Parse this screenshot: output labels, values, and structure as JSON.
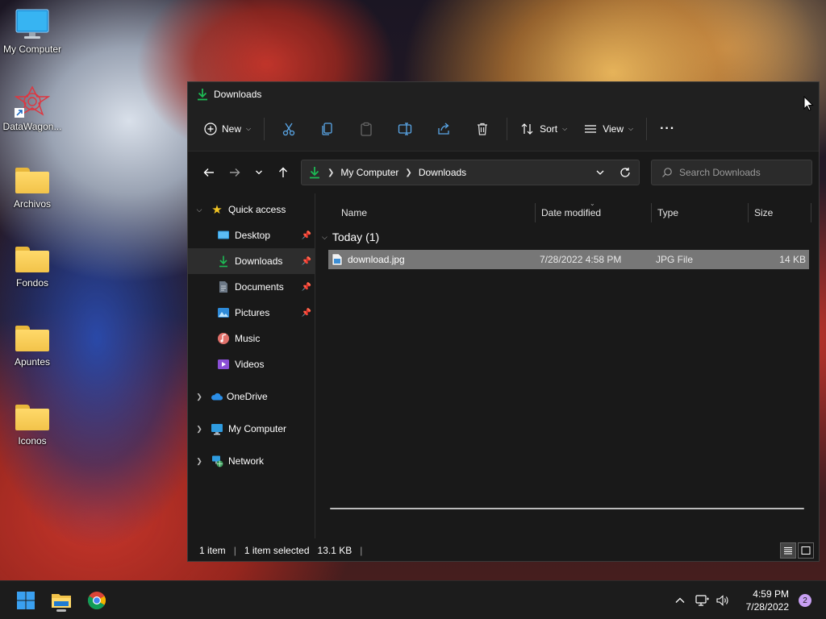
{
  "desktop": {
    "icons": [
      {
        "label": "My Computer",
        "icon": "monitor-icon"
      },
      {
        "label": "DataWagon...",
        "icon": "datawagon-shortcut-icon"
      },
      {
        "label": "Archivos",
        "icon": "folder-icon"
      },
      {
        "label": "Fondos",
        "icon": "folder-icon"
      },
      {
        "label": "Apuntes",
        "icon": "folder-icon"
      },
      {
        "label": "Iconos",
        "icon": "folder-icon"
      }
    ]
  },
  "window": {
    "title": "Downloads",
    "toolbar": {
      "new_label": "New",
      "sort_label": "Sort",
      "view_label": "View",
      "more_label": "···"
    },
    "address": {
      "crumbs": [
        "My Computer",
        "Downloads"
      ]
    },
    "search": {
      "placeholder": "Search Downloads"
    },
    "nav": {
      "quick_access": "Quick access",
      "items": [
        {
          "label": "Desktop",
          "pinned": true
        },
        {
          "label": "Downloads",
          "pinned": true,
          "selected": true
        },
        {
          "label": "Documents",
          "pinned": true
        },
        {
          "label": "Pictures",
          "pinned": true
        },
        {
          "label": "Music",
          "pinned": false
        },
        {
          "label": "Videos",
          "pinned": false
        }
      ],
      "roots": [
        {
          "label": "OneDrive"
        },
        {
          "label": "My Computer"
        },
        {
          "label": "Network"
        }
      ]
    },
    "columns": [
      "Name",
      "Date modified",
      "Type",
      "Size"
    ],
    "groups": [
      {
        "label": "Today (1)",
        "files": [
          {
            "name": "download.jpg",
            "date": "7/28/2022 4:58 PM",
            "type": "JPG File",
            "size": "14 KB",
            "selected": true
          }
        ]
      }
    ],
    "status": {
      "count": "1 item",
      "selected": "1 item selected",
      "size": "13.1 KB",
      "bar": "|"
    }
  },
  "taskbar": {
    "time": "4:59 PM",
    "date": "7/28/2022",
    "notifications": "2"
  },
  "colors": {
    "accent_green": "#1db954",
    "window_bg": "#191919",
    "command_bg": "#202020",
    "selection": "#777777"
  }
}
